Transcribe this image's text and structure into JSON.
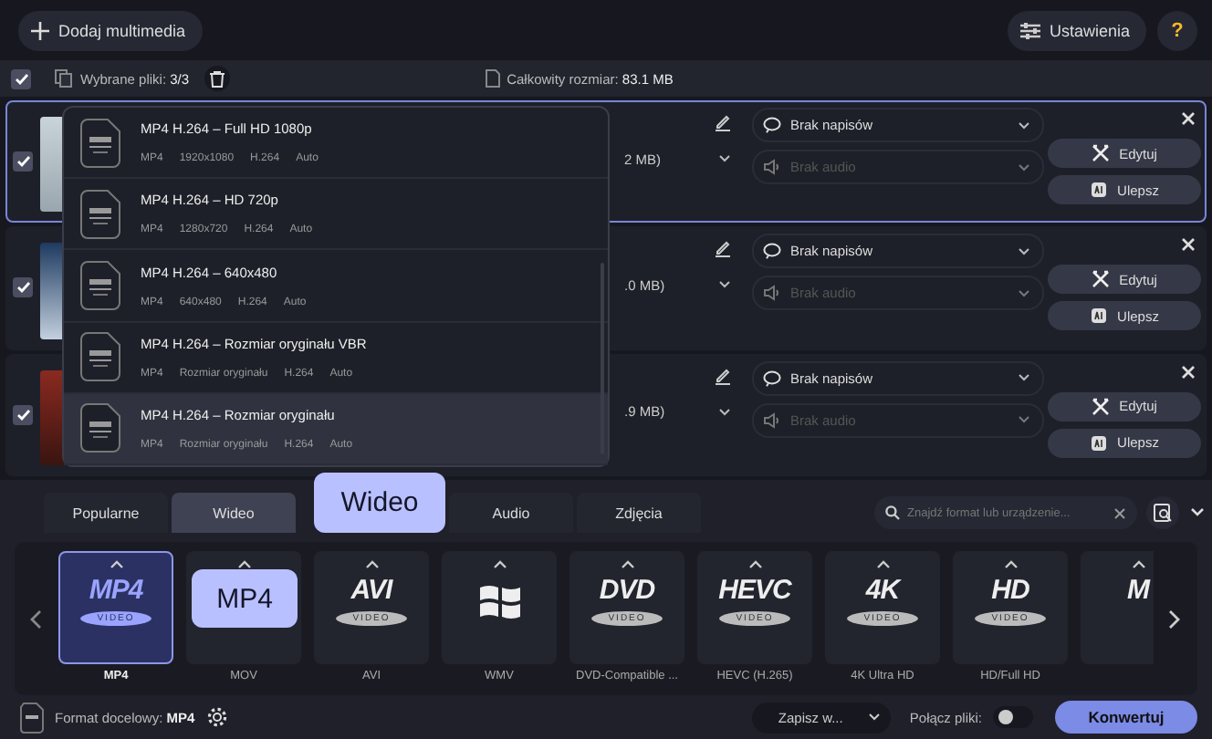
{
  "toolbar": {
    "add_button": "Dodaj multimedia",
    "settings_button": "Ustawienia",
    "help_button": "?"
  },
  "selection_bar": {
    "checked": true,
    "selected_label": "Wybrane pliki:",
    "selected_value": "3/3",
    "size_label": "Całkowity rozmiar:",
    "size_value": "83.1 MB"
  },
  "files": [
    {
      "checked": true,
      "selected": true,
      "size": "2 MB)",
      "subtitles": "Brak napisów",
      "audio": "Brak audio",
      "edit": "Edytuj",
      "enhance": "Ulepsz"
    },
    {
      "checked": true,
      "selected": false,
      "size": ".0 MB)",
      "subtitles": "Brak napisów",
      "audio": "Brak audio",
      "edit": "Edytuj",
      "enhance": "Ulepsz"
    },
    {
      "checked": true,
      "selected": false,
      "size": ".9 MB)",
      "subtitles": "Brak napisów",
      "audio": "Brak audio",
      "edit": "Edytuj",
      "enhance": "Ulepsz"
    }
  ],
  "preset_menu": [
    {
      "title": "MP4 H.264 – Full HD 1080p",
      "specs": [
        "MP4",
        "1920x1080",
        "H.264",
        "Auto"
      ],
      "selected": false
    },
    {
      "title": "MP4 H.264 – HD 720p",
      "specs": [
        "MP4",
        "1280x720",
        "H.264",
        "Auto"
      ],
      "selected": false
    },
    {
      "title": "MP4 H.264 – 640x480",
      "specs": [
        "MP4",
        "640x480",
        "H.264",
        "Auto"
      ],
      "selected": false
    },
    {
      "title": "MP4 H.264 – Rozmiar oryginału VBR",
      "specs": [
        "MP4",
        "Rozmiar oryginału",
        "H.264",
        "Auto"
      ],
      "selected": false
    },
    {
      "title": "MP4 H.264 – Rozmiar oryginału",
      "specs": [
        "MP4",
        "Rozmiar oryginału",
        "H.264",
        "Auto"
      ],
      "selected": true
    }
  ],
  "format_tabs": [
    {
      "label": "Popularne",
      "selected": false
    },
    {
      "label": "Wideo",
      "selected": true
    },
    {
      "label": "Audio",
      "selected": false
    },
    {
      "label": "Zdjęcia",
      "selected": false
    }
  ],
  "format_search": {
    "placeholder": "Znajdź format lub urządzenie..."
  },
  "formats": [
    {
      "kind": "text",
      "logo": "MP4",
      "sub": "VIDEO",
      "label": "MP4",
      "selected": true
    },
    {
      "kind": "hidden",
      "label": "MOV",
      "selected": false
    },
    {
      "kind": "text",
      "logo": "AVI",
      "sub": "VIDEO",
      "label": "AVI",
      "selected": false
    },
    {
      "kind": "windows",
      "label": "WMV",
      "selected": false
    },
    {
      "kind": "text",
      "logo": "DVD",
      "sub": "VIDEO",
      "label": "DVD-Compatible ...",
      "selected": false
    },
    {
      "kind": "text",
      "logo": "HEVC",
      "sub": "VIDEO",
      "label": "HEVC (H.265)",
      "selected": false
    },
    {
      "kind": "text",
      "logo": "4K",
      "sub": "VIDEO",
      "label": "4K Ultra HD",
      "selected": false
    },
    {
      "kind": "text",
      "logo": "HD",
      "sub": "VIDEO",
      "label": "HD/Full HD",
      "selected": false
    },
    {
      "kind": "text",
      "logo": "M",
      "selected": false
    }
  ],
  "callouts": [
    {
      "text": "Wideo"
    },
    {
      "text": "MP4"
    }
  ],
  "bottom_bar": {
    "format_label": "Format docelowy:",
    "format_value": "MP4",
    "save_button": "Zapisz w...",
    "merge_label": "Połącz pliki:",
    "merge_on": false,
    "convert_button": "Konwertuj"
  }
}
